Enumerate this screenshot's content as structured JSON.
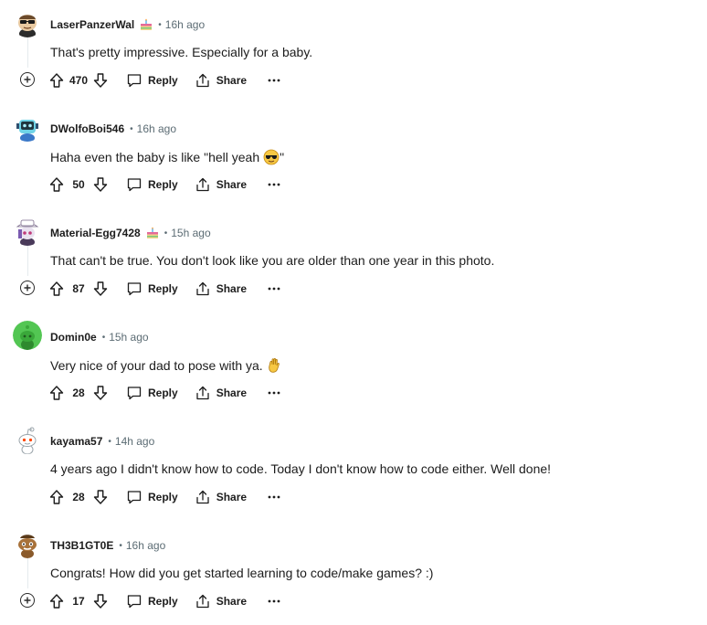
{
  "comments": [
    {
      "username": "LaserPanzerWal",
      "has_flair": true,
      "separator": "•",
      "time": "16h ago",
      "text": "That's pretty impressive. Especially for a baby.",
      "emoji": "",
      "score": "470",
      "reply_label": "Reply",
      "share_label": "Share",
      "avatar": "avatar-sunglasses-icon",
      "has_thread_line": true
    },
    {
      "username": "DWolfoBoi546",
      "has_flair": false,
      "separator": "•",
      "time": "16h ago",
      "text": "Haha even the baby is like \"hell yeah",
      "emoji": "smiling-face-with-sunglasses-icon",
      "text_after": "\"",
      "score": "50",
      "reply_label": "Reply",
      "share_label": "Share",
      "avatar": "avatar-robot-icon",
      "has_thread_line": false
    },
    {
      "username": "Material-Egg7428",
      "has_flair": true,
      "separator": "•",
      "time": "15h ago",
      "text": "That can't be true. You don't look like you are older than one year in this photo.",
      "emoji": "",
      "score": "87",
      "reply_label": "Reply",
      "share_label": "Share",
      "avatar": "avatar-hat-icon",
      "has_thread_line": true
    },
    {
      "username": "Domin0e",
      "has_flair": false,
      "separator": "•",
      "time": "15h ago",
      "text": "Very nice of your dad to pose with ya.",
      "emoji": "ok-hand-icon",
      "score": "28",
      "reply_label": "Reply",
      "share_label": "Share",
      "avatar": "avatar-green-snoo-icon",
      "has_thread_line": false
    },
    {
      "username": "kayama57",
      "has_flair": false,
      "separator": "•",
      "time": "14h ago",
      "text": "4 years ago I didn't know how to code. Today I don't know how to code either. Well done!",
      "emoji": "",
      "score": "28",
      "reply_label": "Reply",
      "share_label": "Share",
      "avatar": "avatar-default-snoo-icon",
      "has_thread_line": false
    },
    {
      "username": "TH3B1GT0E",
      "has_flair": false,
      "separator": "•",
      "time": "16h ago",
      "text": "Congrats! How did you get started learning to code/make games? :)",
      "emoji": "",
      "score": "17",
      "reply_label": "Reply",
      "share_label": "Share",
      "avatar": "avatar-brown-snoo-icon",
      "has_thread_line": true
    }
  ],
  "colors": {
    "text_primary": "#1c1c1c",
    "text_meta": "#5c6c74",
    "thread_line": "#e5ebee"
  }
}
